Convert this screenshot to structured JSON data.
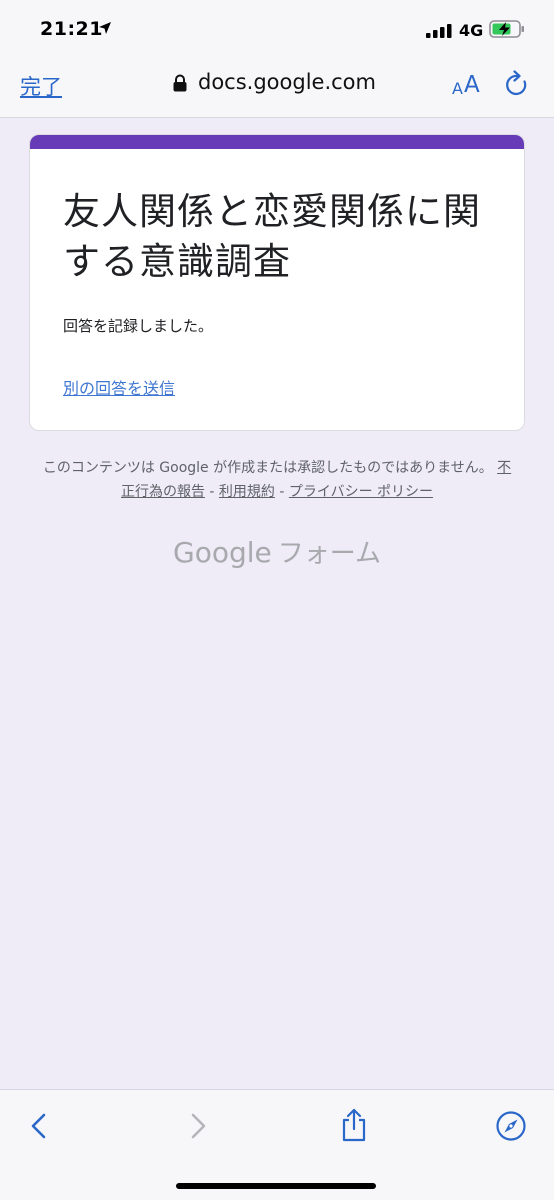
{
  "status_bar": {
    "time": "21:21",
    "network": "4G"
  },
  "nav": {
    "done_label": "完了",
    "url": "docs.google.com",
    "text_size_small": "A",
    "text_size_large": "A"
  },
  "form": {
    "title": "友人関係と恋愛関係に関する意識調査",
    "confirmation": "回答を記録しました。",
    "another_response": "別の回答を送信",
    "accent_color": "#673ab7"
  },
  "footer": {
    "disclaimer": "このコンテンツは Google が作成または承認したものではありません。",
    "abuse_link": "不正行為の報告",
    "terms_link": "利用規約",
    "privacy_link": "プライバシー ポリシー",
    "separator": " - ",
    "logo_google": "Google",
    "logo_forms": "フォーム"
  },
  "icons": {
    "back": "chevron-left-icon",
    "forward": "chevron-right-icon",
    "share": "share-icon",
    "compass": "compass-icon"
  }
}
